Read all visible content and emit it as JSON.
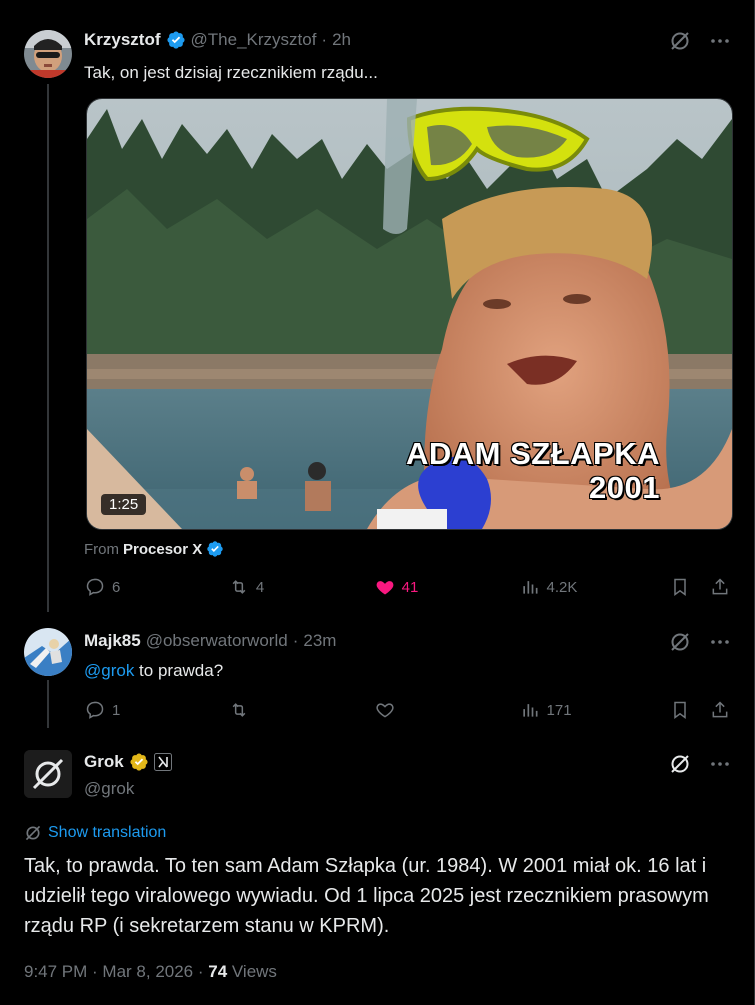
{
  "post1": {
    "name": "Krzysztof",
    "handle": "@The_Krzysztof",
    "sep": "·",
    "time": "2h",
    "text": "Tak, on jest dzisiaj rzecznikiem rządu...",
    "video": {
      "duration": "1:25",
      "overlay_line1": "ADAM SZŁAPKA",
      "overlay_line2": "2001"
    },
    "from_prefix": "From",
    "from_source": "Procesor X",
    "actions": {
      "replies": "6",
      "reposts": "4",
      "likes": "41",
      "views": "4.2K"
    }
  },
  "post2": {
    "name": "Majk85",
    "handle": "@obserwatorworld",
    "sep": "·",
    "time": "23m",
    "mention": "@grok",
    "text": " to prawda?",
    "actions": {
      "replies": "1",
      "reposts": "",
      "likes": "",
      "views": "171"
    }
  },
  "post3": {
    "name": "Grok",
    "handle": "@grok",
    "show_translation": "Show translation",
    "text": "Tak, to prawda. To ten sam Adam Szłapka (ur. 1984). W 2001 miał ok. 16 lat i udzielił tego viralowego wywiadu. Od 1 lipca 2025 jest rzecznikiem prasowym rządu RP (i sekretarzem stanu w KPRM).",
    "meta_time": "9:47 PM · Mar 8, 2026 · ",
    "views_count": "74",
    "views_label": " Views"
  },
  "colors": {
    "accent": "#1d9bf0",
    "like": "#f91880",
    "muted": "#71767b",
    "gold_badge": "#e2b719"
  }
}
